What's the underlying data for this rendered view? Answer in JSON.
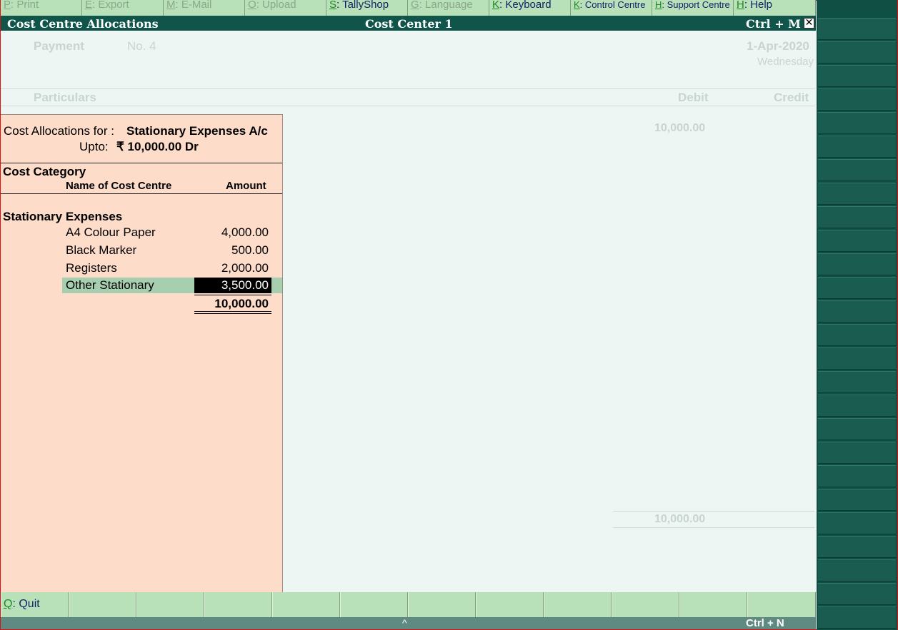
{
  "top_menu": [
    {
      "key": "P",
      "label": ": Print",
      "enabled": false
    },
    {
      "key": "E",
      "label": ": Export",
      "enabled": false
    },
    {
      "key": "M",
      "label": ": E-Mail",
      "enabled": false
    },
    {
      "key": "O",
      "label": ": Upload",
      "enabled": false
    },
    {
      "key": "S",
      "label": ": TallyShop",
      "enabled": true
    },
    {
      "key": "G",
      "label": ": Language",
      "enabled": false
    },
    {
      "key": "K",
      "label": ": Keyboard",
      "enabled": true
    },
    {
      "key": "K",
      "label": ": Control Centre",
      "enabled": true
    },
    {
      "key": "H",
      "label": ": Support Centre",
      "enabled": true
    },
    {
      "key": "H",
      "label": ": Help",
      "enabled": true
    }
  ],
  "title_bar": {
    "left": "Cost Centre Allocations",
    "center": "Cost Center 1",
    "right": "Ctrl + M",
    "close_glyph": "✕"
  },
  "voucher": {
    "type": "Payment",
    "number": "No. 4",
    "date": "1-Apr-2020",
    "day": "Wednesday",
    "col_particulars": "Particulars",
    "col_debit": "Debit",
    "col_credit": "Credit",
    "debit_amount": "10,000.00",
    "total_debit": "10,000.00"
  },
  "allocation": {
    "for_label": "Cost Allocations for :",
    "ledger": "Stationary Expenses A/c",
    "upto_label": "Upto:",
    "upto_amount": "₹ 10,000.00 Dr",
    "col_category": "Cost Category",
    "col_name": "Name of Cost Centre",
    "col_amount": "Amount",
    "category": "Stationary Expenses",
    "rows": [
      {
        "name": "A4 Colour Paper",
        "amount": "4,000.00"
      },
      {
        "name": "Black Marker",
        "amount": "500.00"
      },
      {
        "name": "Registers",
        "amount": "2,000.00"
      },
      {
        "name": "Other Stationary",
        "amount": "3,500.00"
      }
    ],
    "total": "10,000.00"
  },
  "bottom_bar": {
    "quit_key": "Q",
    "quit_label": ": Quit"
  },
  "status_bar": {
    "caret": "^",
    "shortcut": "Ctrl + N"
  },
  "colors": {
    "menu_bg": "#b9e1b9",
    "title_bg": "#11544a",
    "panel_bg": "#fddcc9",
    "selection_bg": "#a8ceb0"
  }
}
